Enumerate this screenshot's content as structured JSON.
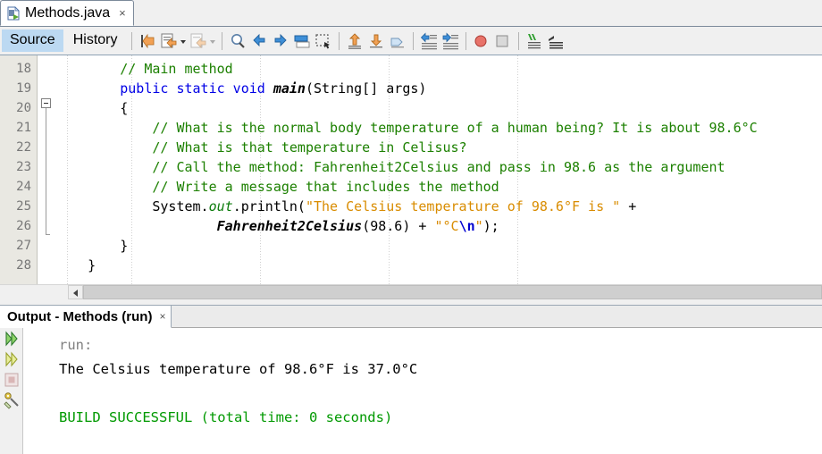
{
  "window": {
    "file_tab": {
      "label": "Methods.java",
      "icon": "java-file-icon",
      "close": "×"
    }
  },
  "editor": {
    "mode_tabs": [
      {
        "label": "Source",
        "active": true
      },
      {
        "label": "History",
        "active": false
      }
    ],
    "toolbar": {
      "icons": [
        "last-edit-icon",
        "toggle-bookmark-icon",
        "toggle-bookmark-dropdown-icon",
        "next-bookmark-icon",
        "next-bookmark-dropdown-icon",
        "find-selection-icon",
        "previous-occurrence-icon",
        "next-occurrence-icon",
        "toggle-highlight-icon",
        "rectangular-selection-icon",
        "previous-bookmark-icon",
        "next-bookmark-down-icon",
        "shift-line-icon",
        "shift-line-left-icon",
        "shift-line-right-icon",
        "toggle-breakpoint-icon",
        "stop-icon",
        "comment-icon",
        "uncomment-icon"
      ]
    },
    "line_numbers": [
      "18",
      "19",
      "20",
      "21",
      "22",
      "23",
      "24",
      "25",
      "26",
      "27",
      "28"
    ],
    "lines": [
      {
        "number": "18",
        "segments": [
          {
            "text": "        ",
            "cls": "br"
          },
          {
            "text": "// Main method",
            "cls": "cmt"
          }
        ]
      },
      {
        "number": "19",
        "segments": [
          {
            "text": "        ",
            "cls": "br"
          },
          {
            "text": "public static void ",
            "cls": "kw"
          },
          {
            "text": "main",
            "cls": "mth"
          },
          {
            "text": "(String[] args)",
            "cls": "br"
          }
        ]
      },
      {
        "number": "20",
        "segments": [
          {
            "text": "        {",
            "cls": "br"
          }
        ]
      },
      {
        "number": "21",
        "segments": [
          {
            "text": "            ",
            "cls": "br"
          },
          {
            "text": "// What is the normal body temperature of a human being? It is about 98.6°C",
            "cls": "cmt"
          }
        ]
      },
      {
        "number": "22",
        "segments": [
          {
            "text": "            ",
            "cls": "br"
          },
          {
            "text": "// What is that temperature in Celisus?",
            "cls": "cmt"
          }
        ]
      },
      {
        "number": "23",
        "segments": [
          {
            "text": "            ",
            "cls": "br"
          },
          {
            "text": "// Call the method: Fahrenheit2Celsius and pass in 98.6 as the argument",
            "cls": "cmt"
          }
        ]
      },
      {
        "number": "24",
        "segments": [
          {
            "text": "            ",
            "cls": "br"
          },
          {
            "text": "// Write a message that includes the method",
            "cls": "cmt"
          }
        ]
      },
      {
        "number": "25",
        "segments": [
          {
            "text": "            System.",
            "cls": "br"
          },
          {
            "text": "out",
            "cls": "fld"
          },
          {
            "text": ".println(",
            "cls": "br"
          },
          {
            "text": "\"The Celsius temperature of 98.6°F is \"",
            "cls": "str"
          },
          {
            "text": " +",
            "cls": "br"
          }
        ]
      },
      {
        "number": "26",
        "segments": [
          {
            "text": "                    ",
            "cls": "br"
          },
          {
            "text": "Fahrenheit2Celsius",
            "cls": "mth"
          },
          {
            "text": "(98.6) + ",
            "cls": "br"
          },
          {
            "text": "\"°C",
            "cls": "str"
          },
          {
            "text": "\\n",
            "cls": "esc"
          },
          {
            "text": "\"",
            "cls": "str"
          },
          {
            "text": ");",
            "cls": "br"
          }
        ]
      },
      {
        "number": "27",
        "segments": [
          {
            "text": "        }",
            "cls": "br"
          }
        ]
      },
      {
        "number": "28",
        "segments": [
          {
            "text": "    }",
            "cls": "br"
          }
        ]
      }
    ],
    "scrollbar": {
      "left_button": "‹"
    }
  },
  "output": {
    "tab": {
      "label": "Output - Methods (run)",
      "close": "×"
    },
    "tools": [
      "rerun-icon",
      "rerun-alt-icon",
      "stop-icon",
      "settings-icon"
    ],
    "lines": [
      {
        "text": "run:",
        "cls": "o-dim"
      },
      {
        "text": "The Celsius temperature of 98.6°F is 37.0°C",
        "cls": "o-black"
      },
      {
        "text": "",
        "cls": "o-black"
      },
      {
        "text": "BUILD SUCCESSFUL (total time: 0 seconds)",
        "cls": "o-green"
      }
    ]
  },
  "colors": {
    "comment": "#1c8000",
    "keyword": "#0000e6",
    "string": "#d98c00",
    "build_success": "#009900",
    "active_tab": "#bcd9f2"
  }
}
